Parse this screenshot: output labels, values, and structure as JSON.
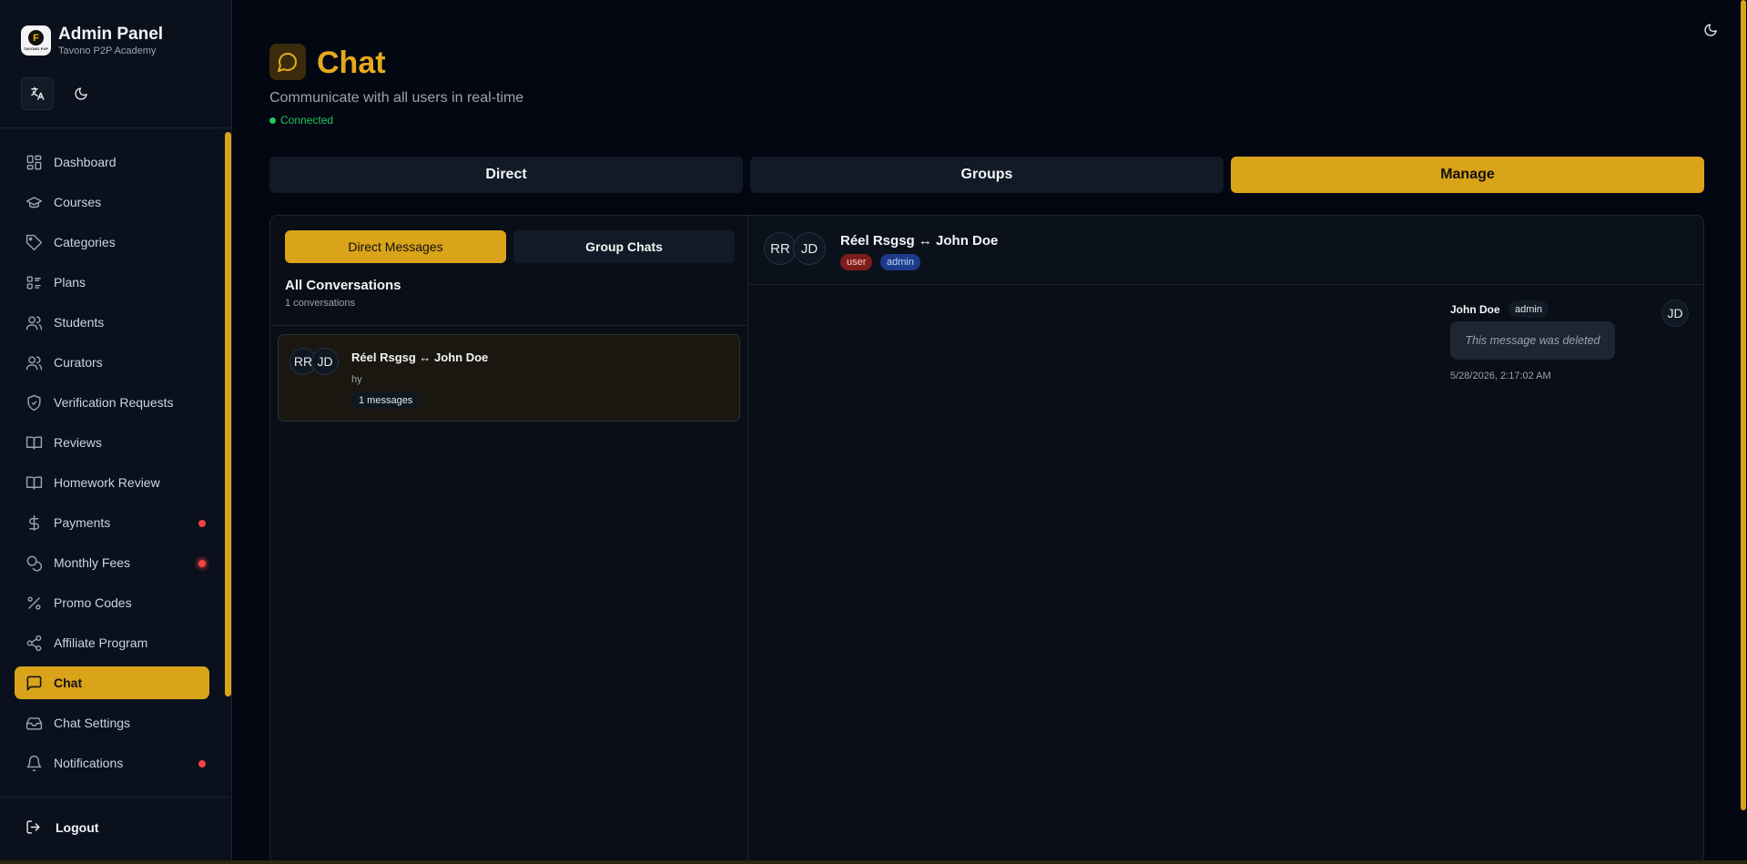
{
  "brand": {
    "title": "Admin Panel",
    "subtitle": "Tavono P2P Academy",
    "logo_text": "TAVONO P2P"
  },
  "sidebar": {
    "items": [
      {
        "label": "Dashboard",
        "icon": "dashboard-icon"
      },
      {
        "label": "Courses",
        "icon": "graduation-cap-icon"
      },
      {
        "label": "Categories",
        "icon": "tag-icon"
      },
      {
        "label": "Plans",
        "icon": "list-icon"
      },
      {
        "label": "Students",
        "icon": "users-icon"
      },
      {
        "label": "Curators",
        "icon": "users-icon"
      },
      {
        "label": "Verification Requests",
        "icon": "shield-check-icon"
      },
      {
        "label": "Reviews",
        "icon": "book-icon"
      },
      {
        "label": "Homework Review",
        "icon": "book-icon"
      },
      {
        "label": "Payments",
        "icon": "dollar-icon"
      },
      {
        "label": "Monthly Fees",
        "icon": "coins-icon"
      },
      {
        "label": "Promo Codes",
        "icon": "percent-icon"
      },
      {
        "label": "Affiliate Program",
        "icon": "share-icon"
      },
      {
        "label": "Chat",
        "icon": "chat-icon"
      },
      {
        "label": "Chat Settings",
        "icon": "inbox-icon"
      },
      {
        "label": "Notifications",
        "icon": "bell-icon"
      }
    ],
    "logout_label": "Logout"
  },
  "colors": {
    "accent": "#d9a31a",
    "accent_text": "#e5aa1c",
    "connected": "#22c55e",
    "alert": "#ef4444"
  },
  "page": {
    "title": "Chat",
    "subtitle": "Communicate with all users in real-time",
    "status": "Connected"
  },
  "tabs": [
    "Direct",
    "Groups",
    "Manage"
  ],
  "subtabs": [
    "Direct Messages",
    "Group Chats"
  ],
  "list": {
    "title": "All Conversations",
    "count": "1 conversations",
    "conversations": [
      {
        "initials_a": "RR",
        "initials_b": "JD",
        "name": "Réel Rsgsg ↔ John Doe",
        "preview": "hy",
        "badge": "1 messages"
      }
    ]
  },
  "chat": {
    "initials_a": "RR",
    "initials_b": "JD",
    "title": "Réel Rsgsg ↔ John Doe",
    "roles": [
      "user",
      "admin"
    ],
    "messages": [
      {
        "sender": "John Doe",
        "role": "admin",
        "text": "This message was deleted",
        "time": "5/28/2026, 2:17:02 AM",
        "initials": "JD"
      }
    ]
  }
}
